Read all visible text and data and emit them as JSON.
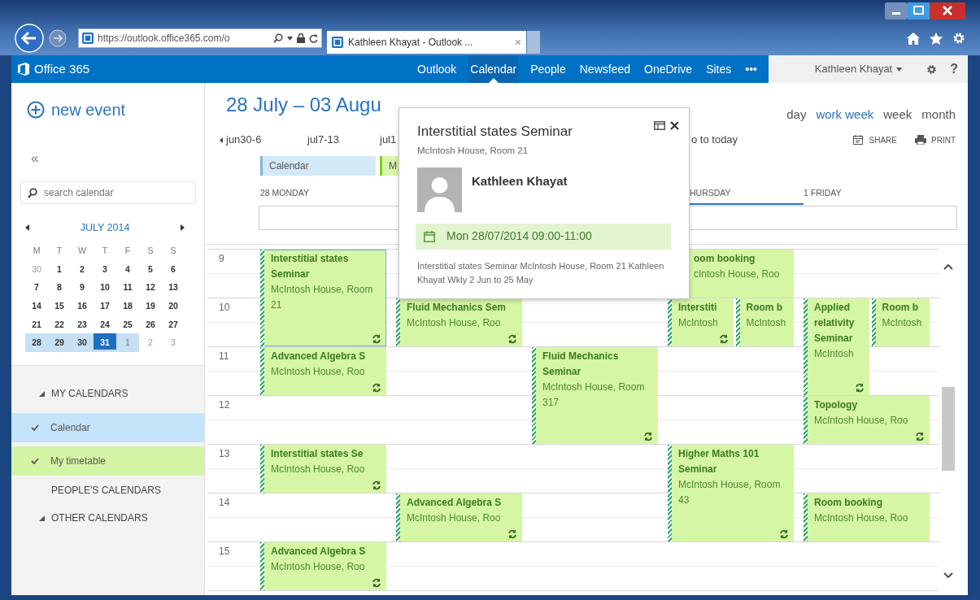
{
  "browser": {
    "address": "https://outlook.office365.com/o",
    "tab_title": "Kathleen Khayat - Outlook ...",
    "tab_close": "×"
  },
  "suite_bar": {
    "brand": "Office 365",
    "nav": [
      {
        "label": "Outlook",
        "selected": false
      },
      {
        "label": "Calendar",
        "selected": true
      },
      {
        "label": "People",
        "selected": false
      },
      {
        "label": "Newsfeed",
        "selected": false
      },
      {
        "label": "OneDrive",
        "selected": false
      },
      {
        "label": "Sites",
        "selected": false
      },
      {
        "label": "•••",
        "selected": false
      }
    ],
    "user": "Kathleen Khayat",
    "help": "?"
  },
  "sidebar": {
    "new_event": "new event",
    "collapse": "«",
    "search": {
      "placeholder": "search calendar"
    },
    "mini_calendar": {
      "month": "JULY 2014",
      "weekdays": [
        "M",
        "T",
        "W",
        "T",
        "F",
        "S",
        "S"
      ],
      "weeks": [
        [
          {
            "label": "30",
            "muted": true,
            "selected": false,
            "today": false
          },
          {
            "label": "1",
            "muted": false,
            "selected": false,
            "today": false
          },
          {
            "label": "2",
            "muted": false,
            "selected": false,
            "today": false
          },
          {
            "label": "3",
            "muted": false,
            "selected": false,
            "today": false
          },
          {
            "label": "4",
            "muted": false,
            "selected": false,
            "today": false
          },
          {
            "label": "5",
            "muted": false,
            "selected": false,
            "today": false
          },
          {
            "label": "6",
            "muted": false,
            "selected": false,
            "today": false
          }
        ],
        [
          {
            "label": "7",
            "muted": false,
            "selected": false,
            "today": false
          },
          {
            "label": "8",
            "muted": false,
            "selected": false,
            "today": false
          },
          {
            "label": "9",
            "muted": false,
            "selected": false,
            "today": false
          },
          {
            "label": "10",
            "muted": false,
            "selected": false,
            "today": false
          },
          {
            "label": "11",
            "muted": false,
            "selected": false,
            "today": false
          },
          {
            "label": "12",
            "muted": false,
            "selected": false,
            "today": false
          },
          {
            "label": "13",
            "muted": false,
            "selected": false,
            "today": false
          }
        ],
        [
          {
            "label": "14",
            "muted": false,
            "selected": false,
            "today": false
          },
          {
            "label": "15",
            "muted": false,
            "selected": false,
            "today": false
          },
          {
            "label": "16",
            "muted": false,
            "selected": false,
            "today": false
          },
          {
            "label": "17",
            "muted": false,
            "selected": false,
            "today": false
          },
          {
            "label": "18",
            "muted": false,
            "selected": false,
            "today": false
          },
          {
            "label": "19",
            "muted": false,
            "selected": false,
            "today": false
          },
          {
            "label": "20",
            "muted": false,
            "selected": false,
            "today": false
          }
        ],
        [
          {
            "label": "21",
            "muted": false,
            "selected": false,
            "today": false
          },
          {
            "label": "22",
            "muted": false,
            "selected": false,
            "today": false
          },
          {
            "label": "23",
            "muted": false,
            "selected": false,
            "today": false
          },
          {
            "label": "24",
            "muted": false,
            "selected": false,
            "today": false
          },
          {
            "label": "25",
            "muted": false,
            "selected": false,
            "today": false
          },
          {
            "label": "26",
            "muted": false,
            "selected": false,
            "today": false
          },
          {
            "label": "27",
            "muted": false,
            "selected": false,
            "today": false
          }
        ],
        [
          {
            "label": "28",
            "muted": false,
            "selected": true,
            "today": false
          },
          {
            "label": "29",
            "muted": false,
            "selected": true,
            "today": false
          },
          {
            "label": "30",
            "muted": false,
            "selected": true,
            "today": false
          },
          {
            "label": "31",
            "muted": false,
            "selected": true,
            "today": true
          },
          {
            "label": "1",
            "muted": true,
            "selected": true,
            "today": false
          },
          {
            "label": "2",
            "muted": true,
            "selected": false,
            "today": false
          },
          {
            "label": "3",
            "muted": true,
            "selected": false,
            "today": false
          }
        ]
      ]
    },
    "sections": [
      {
        "label": "MY CALENDARS",
        "expanded": true,
        "items": [
          {
            "label": "Calendar",
            "checked": true,
            "color": "#c4e4fa"
          },
          {
            "label": "My timetable",
            "checked": true,
            "color": "#d4f5a6"
          }
        ]
      },
      {
        "label": "PEOPLE'S CALENDARS",
        "expanded": false
      },
      {
        "label": "OTHER CALENDARS",
        "expanded": true
      }
    ]
  },
  "calendar": {
    "title": "28 July – 03 Augu",
    "views": [
      {
        "label": "day",
        "selected": false
      },
      {
        "label": "work week",
        "selected": true
      },
      {
        "label": "week",
        "selected": false
      },
      {
        "label": "month",
        "selected": false
      }
    ],
    "week_nav": [
      "jun30-6",
      "jul7-13",
      "jul1",
      "o to today"
    ],
    "actions": [
      "SHARE",
      "PRINT"
    ],
    "legend": [
      {
        "label": "Calendar",
        "color": "#d3e9f8"
      },
      {
        "label": "M",
        "color": "#d7f5ab"
      }
    ],
    "hours": [
      "9",
      "10",
      "11",
      "12",
      "13",
      "14",
      "15"
    ],
    "days": [
      {
        "header": {
          "label": "28 MONDAY",
          "selected": false,
          "covered": false
        },
        "hours": [
          {
            "kind": "booked",
            "events": [
              {
                "title": "Interstitial states Seminar",
                "location": "McIntosh House, Room 21",
                "kind": "two-hour",
                "recurring": true,
                "selected": true,
                "covered": false
              }
            ]
          },
          {
            "kind": "free"
          },
          {
            "kind": "booked",
            "events": [
              {
                "title": "Advanced Algebra S",
                "location": "McIntosh House, Roo",
                "kind": "one-hour",
                "recurring": true,
                "selected": false,
                "covered": false
              }
            ]
          },
          {
            "kind": "free"
          },
          {
            "kind": "booked",
            "events": [
              {
                "title": "Interstitial states Se",
                "location": "McIntosh House, Roo",
                "kind": "one-hour",
                "recurring": true,
                "selected": false,
                "covered": false
              }
            ]
          },
          {
            "kind": "free"
          },
          {
            "kind": "booked",
            "events": [
              {
                "title": "Advanced Algebra S",
                "location": "McIntosh House, Roo",
                "kind": "one-hour",
                "recurring": true,
                "selected": false,
                "covered": false
              }
            ]
          }
        ]
      },
      {
        "hours": [
          {
            "kind": "free"
          },
          {
            "kind": "booked",
            "events": [
              {
                "title": "Fluid Mechanics Sem",
                "location": "McIntosh House, Roo",
                "kind": "one-hour",
                "recurring": true,
                "selected": false,
                "covered": false
              }
            ]
          },
          {
            "kind": "free"
          },
          {
            "kind": "free"
          },
          {
            "kind": "free"
          },
          {
            "kind": "booked",
            "events": [
              {
                "title": "Advanced Algebra S",
                "location": "McIntosh House, Roo",
                "kind": "one-hour",
                "recurring": true,
                "selected": false,
                "covered": false
              }
            ]
          }
        ]
      },
      {
        "hours": [
          {
            "kind": "free"
          },
          {
            "kind": "free"
          },
          {
            "kind": "booked",
            "events": [
              {
                "title": "Fluid Mechanics Seminar",
                "location": "McIntosh House, Room 317",
                "kind": "two-hour",
                "recurring": true,
                "selected": false,
                "covered": false
              }
            ]
          }
        ]
      },
      {
        "header": {
          "label": "HURSDAY",
          "selected": true,
          "covered": true
        },
        "hours": [
          {
            "kind": "booked",
            "events": [
              {
                "title": "oom booking",
                "location": "cIntosh House, Roo",
                "kind": "one-hour",
                "recurring": false,
                "selected": false,
                "covered": true
              }
            ]
          },
          {
            "kind": "booked",
            "events": [
              {
                "title": "Interstiti",
                "location": "McIntosh",
                "kind": "one-hour",
                "recurring": true,
                "selected": false,
                "covered": false
              },
              {
                "title": "Room b",
                "location": "McIntosh",
                "kind": "one-hour",
                "recurring": false,
                "selected": false,
                "covered": false
              }
            ]
          },
          {
            "kind": "free"
          },
          {
            "kind": "free"
          },
          {
            "kind": "booked",
            "events": [
              {
                "title": "Higher Maths 101 Seminar",
                "location": "McIntosh House, Room 43",
                "kind": "two-hour",
                "recurring": true,
                "selected": false,
                "covered": false
              }
            ]
          }
        ]
      },
      {
        "header": {
          "label": "1 FRIDAY",
          "selected": false,
          "covered": false
        },
        "hours": [
          {
            "kind": "free"
          },
          {
            "kind": "booked",
            "events": [
              {
                "title": "Applied relativity Seminar",
                "location": "McIntosh",
                "kind": "two-hour",
                "recurring": true,
                "selected": false,
                "covered": false
              },
              {
                "title": "Room b",
                "location": "McIntosh",
                "kind": "one-hour",
                "recurring": false,
                "selected": false,
                "covered": false
              }
            ]
          },
          {
            "kind": "free"
          },
          {
            "kind": "booked",
            "events": [
              {
                "title": "Topology",
                "location": "McIntosh House, Roo",
                "kind": "one-hour",
                "recurring": true,
                "selected": false,
                "covered": false
              }
            ]
          },
          {
            "kind": "free"
          },
          {
            "kind": "booked",
            "events": [
              {
                "title": "Room booking",
                "location": "McIntosh House, Roo",
                "kind": "one-hour",
                "recurring": false,
                "selected": false,
                "covered": false
              }
            ]
          }
        ]
      }
    ]
  },
  "popup": {
    "title": "Interstitial states Seminar",
    "location": "McIntosh House, Room 21",
    "organizer": "Kathleen Khayat",
    "when": "Mon 28/07/2014 09:00-11:00",
    "description": "Interstitial states Seminar McIntosh House, Room 21 Kathleen Khayat Wkly 2 Jun to 25 May"
  }
}
